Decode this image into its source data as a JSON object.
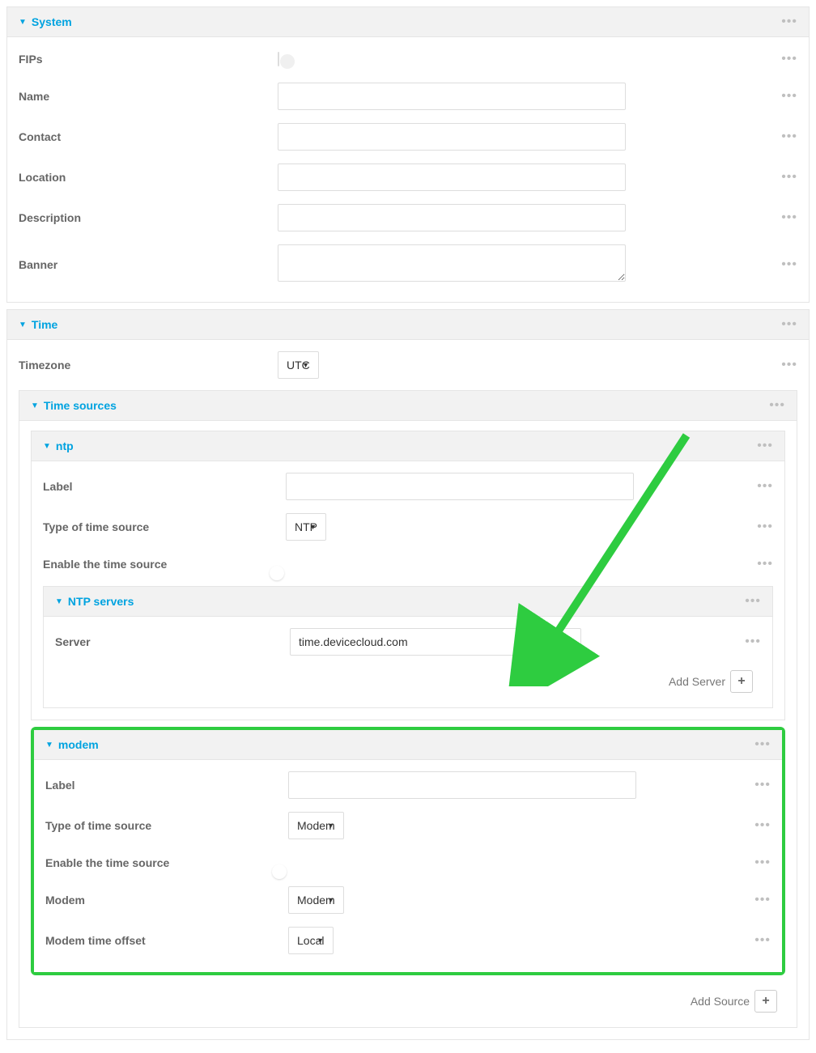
{
  "system": {
    "title": "System",
    "fields": {
      "fips": "FIPs",
      "name": "Name",
      "contact": "Contact",
      "location": "Location",
      "description": "Description",
      "banner": "Banner"
    },
    "values": {
      "fips_enabled": false,
      "name": "",
      "contact": "",
      "location": "",
      "description": "",
      "banner": ""
    }
  },
  "time": {
    "title": "Time",
    "timezone_label": "Timezone",
    "timezone_value": "UTC",
    "sources_title": "Time sources",
    "ntp": {
      "title": "ntp",
      "label_label": "Label",
      "label_value": "",
      "type_label": "Type of time source",
      "type_value": "NTP",
      "enable_label": "Enable the time source",
      "enable_value": true,
      "servers_title": "NTP servers",
      "server_label": "Server",
      "server_value": "time.devicecloud.com",
      "add_server_label": "Add Server"
    },
    "modem": {
      "title": "modem",
      "label_label": "Label",
      "label_value": "",
      "type_label": "Type of time source",
      "type_value": "Modem",
      "enable_label": "Enable the time source",
      "enable_value": true,
      "modem_label": "Modem",
      "modem_value": "Modem",
      "offset_label": "Modem time offset",
      "offset_value": "Local"
    },
    "add_source_label": "Add Source"
  }
}
